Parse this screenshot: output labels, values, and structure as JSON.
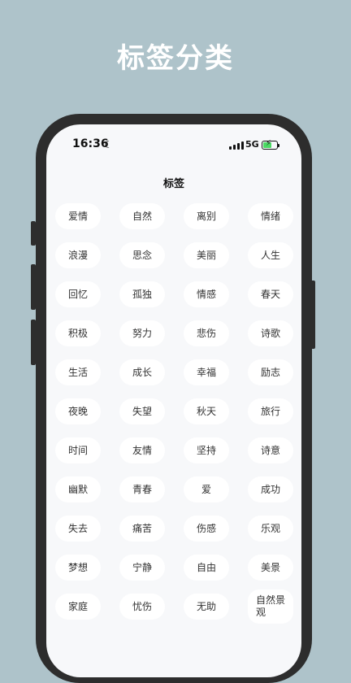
{
  "promo": {
    "title": "标签分类"
  },
  "status": {
    "time": "16:36",
    "network": "5G"
  },
  "page": {
    "title": "标签"
  },
  "tags": [
    "爱情",
    "自然",
    "离别",
    "情绪",
    "浪漫",
    "思念",
    "美丽",
    "人生",
    "回忆",
    "孤独",
    "情感",
    "春天",
    "积极",
    "努力",
    "悲伤",
    "诗歌",
    "生活",
    "成长",
    "幸福",
    "励志",
    "夜晚",
    "失望",
    "秋天",
    "旅行",
    "时间",
    "友情",
    "坚持",
    "诗意",
    "幽默",
    "青春",
    "爱",
    "成功",
    "失去",
    "痛苦",
    "伤感",
    "乐观",
    "梦想",
    "宁静",
    "自由",
    "美景",
    "家庭",
    "忧伤",
    "无助",
    "自然景观"
  ]
}
